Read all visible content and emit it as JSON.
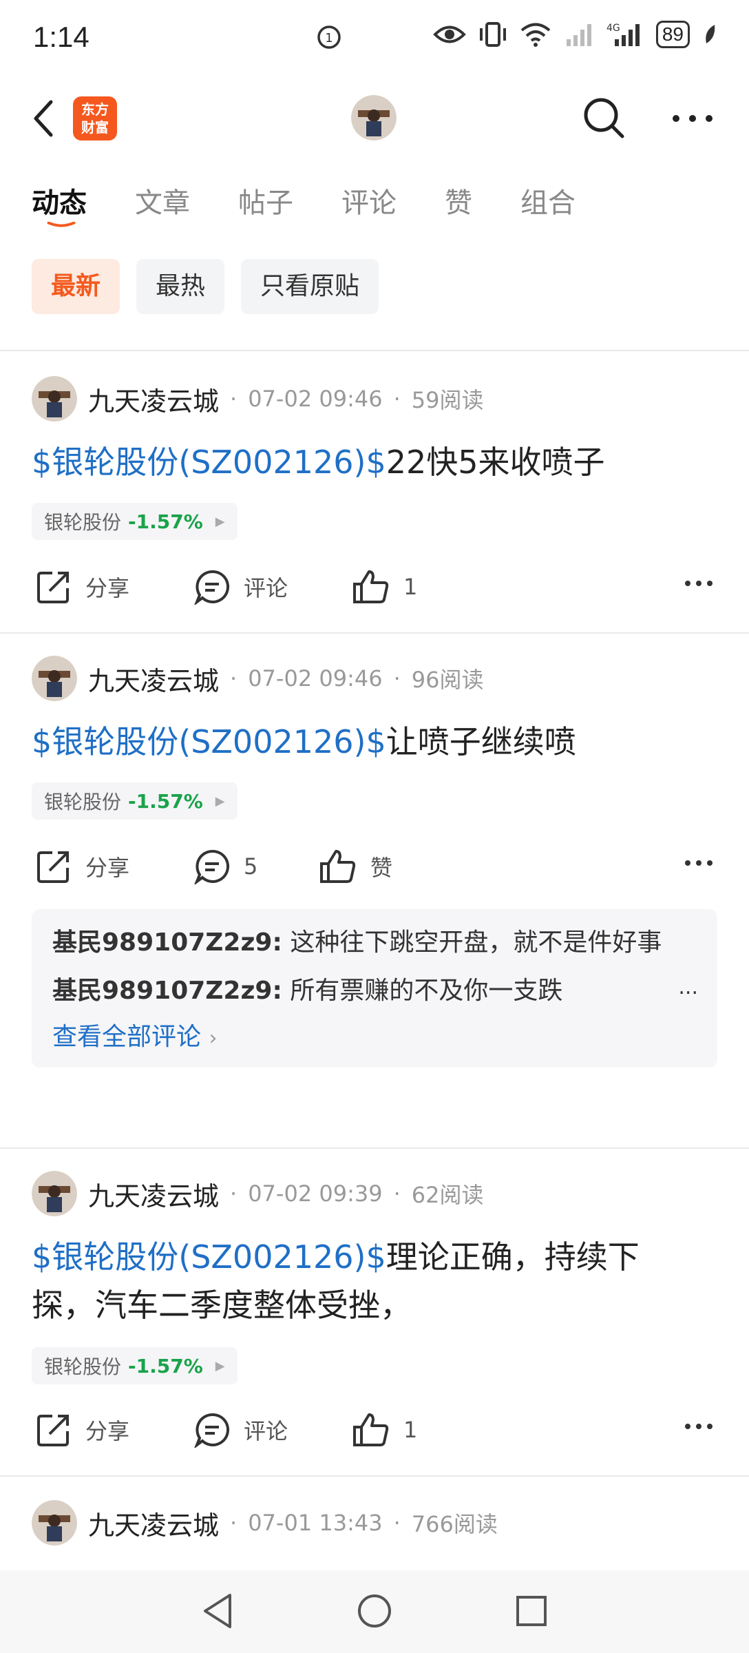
{
  "status_bar": {
    "time": "1:14",
    "battery": "89"
  },
  "header": {
    "logo_text_line1": "东方",
    "logo_text_line2": "财富"
  },
  "tabs": [
    {
      "label": "动态"
    },
    {
      "label": "文章"
    },
    {
      "label": "帖子"
    },
    {
      "label": "评论"
    },
    {
      "label": "赞"
    },
    {
      "label": "组合"
    }
  ],
  "filters": [
    {
      "label": "最新"
    },
    {
      "label": "最热"
    },
    {
      "label": "只看原贴"
    }
  ],
  "posts": [
    {
      "author": "九天凌云城",
      "date": "07-02 09:46",
      "reads": "59阅读",
      "stock_link": "$银轮股份(SZ002126)$",
      "text": "22快5来收喷子",
      "tag_name": "银轮股份",
      "tag_pct": "-1.57%",
      "share": "分享",
      "comment": "评论",
      "like": "1"
    },
    {
      "author": "九天凌云城",
      "date": "07-02 09:46",
      "reads": "96阅读",
      "stock_link": "$银轮股份(SZ002126)$",
      "text": "让喷子继续喷",
      "tag_name": "银轮股份",
      "tag_pct": "-1.57%",
      "share": "分享",
      "comment": "5",
      "like": "赞",
      "comments": [
        {
          "user": "基民989107Z2z9",
          "sep": ":",
          "text": "这种往下跳空开盘，就不是件好事"
        },
        {
          "user": "基民989107Z2z9",
          "sep": ":",
          "text": "所有票赚的不及你一支跌"
        }
      ],
      "view_all": "查看全部评论",
      "more": "..."
    },
    {
      "author": "九天凌云城",
      "date": "07-02 09:39",
      "reads": "62阅读",
      "stock_link": "$银轮股份(SZ002126)$",
      "text": "理论正确，持续下探，汽车二季度整体受挫，",
      "tag_name": "银轮股份",
      "tag_pct": "-1.57%",
      "share": "分享",
      "comment": "评论",
      "like": "1"
    },
    {
      "author": "九天凌云城",
      "date": "07-01 13:43",
      "reads": "766阅读"
    }
  ],
  "colors": {
    "accent": "#f45a1e",
    "link": "#1f6fc6",
    "down": "#1aa34a"
  }
}
